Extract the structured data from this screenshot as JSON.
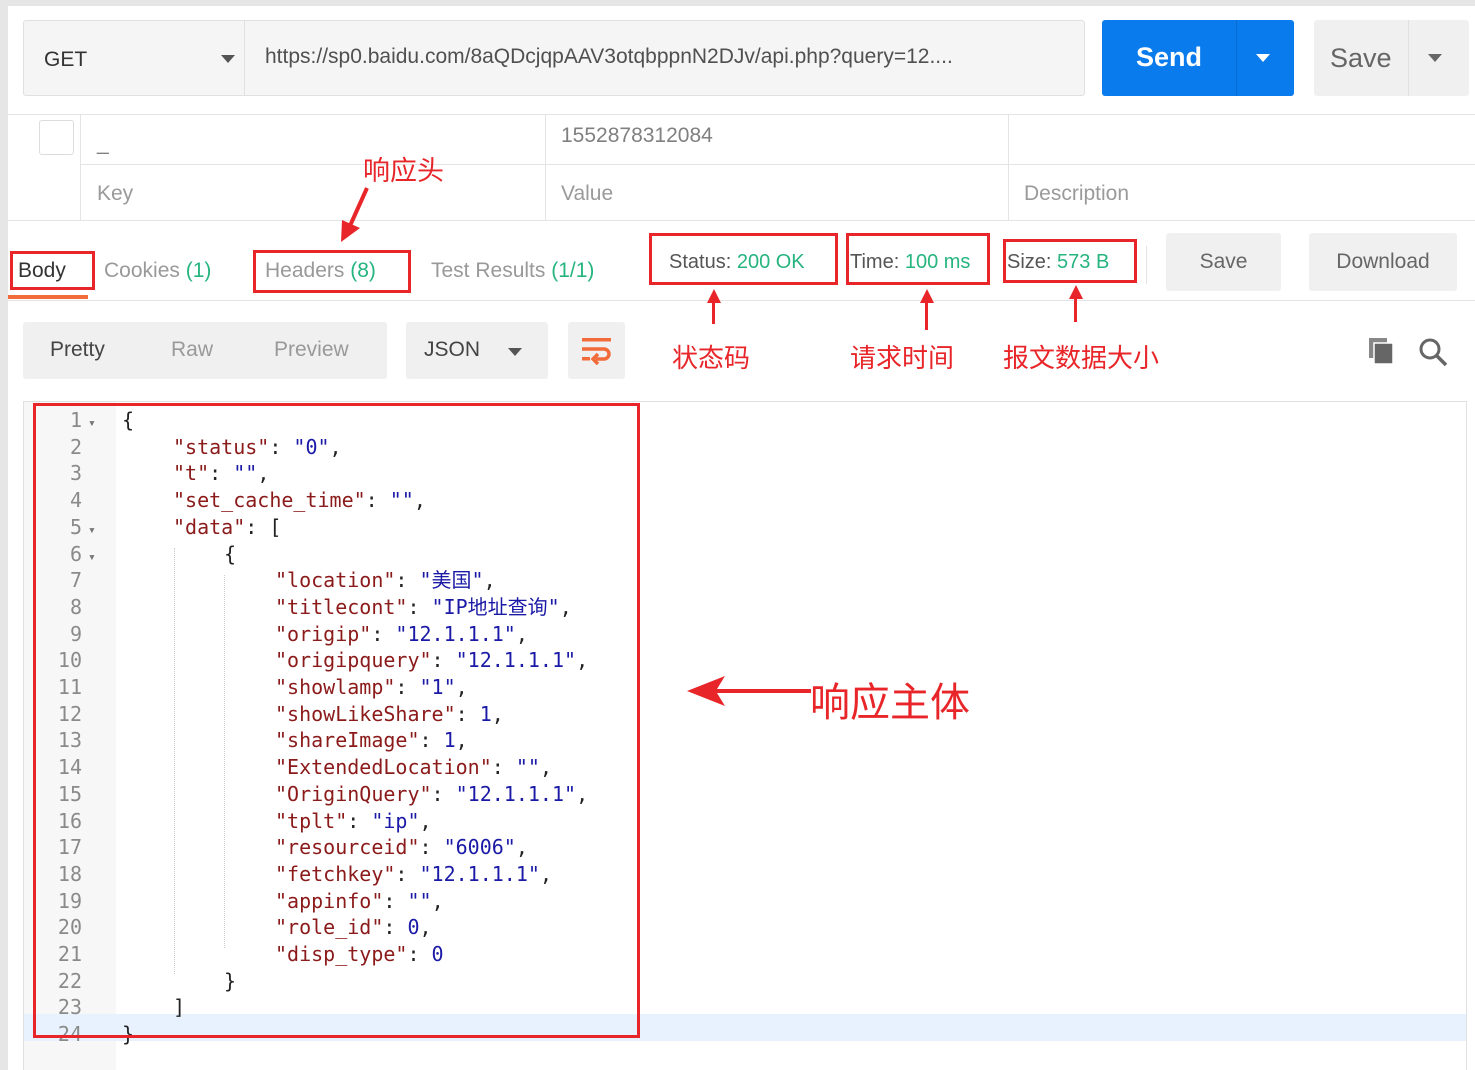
{
  "request": {
    "method": "GET",
    "url": "https://sp0.baidu.com/8aQDcjqpAAV3otqbppnN2DJv/api.php?query=12....",
    "send_label": "Send",
    "save_label": "Save"
  },
  "params": {
    "row": {
      "key": "_",
      "value": "1552878312084",
      "description": ""
    },
    "placeholders": {
      "key": "Key",
      "value": "Value",
      "description": "Description"
    }
  },
  "response": {
    "tabs": [
      {
        "label": "Body",
        "count": ""
      },
      {
        "label": "Cookies",
        "count": "(1)"
      },
      {
        "label": "Headers",
        "count": "(8)"
      },
      {
        "label": "Test Results",
        "count": "(1/1)"
      }
    ],
    "status_label": "Status:",
    "status_value": "200 OK",
    "time_label": "Time:",
    "time_value": "100 ms",
    "size_label": "Size:",
    "size_value": "573 B",
    "save_label": "Save",
    "download_label": "Download"
  },
  "body_toolbar": {
    "views": [
      "Pretty",
      "Raw",
      "Preview"
    ],
    "format": "JSON"
  },
  "editor": {
    "lines": [
      {
        "n": "1",
        "fold": true,
        "indent": 0,
        "parts": [
          [
            "punc",
            "{"
          ]
        ]
      },
      {
        "n": "2",
        "indent": 1,
        "parts": [
          [
            "key",
            "\"status\""
          ],
          [
            "punc",
            ": "
          ],
          [
            "str",
            "\"0\""
          ],
          [
            "punc",
            ","
          ]
        ]
      },
      {
        "n": "3",
        "indent": 1,
        "parts": [
          [
            "key",
            "\"t\""
          ],
          [
            "punc",
            ": "
          ],
          [
            "str",
            "\"\""
          ],
          [
            "punc",
            ","
          ]
        ]
      },
      {
        "n": "4",
        "indent": 1,
        "parts": [
          [
            "key",
            "\"set_cache_time\""
          ],
          [
            "punc",
            ": "
          ],
          [
            "str",
            "\"\""
          ],
          [
            "punc",
            ","
          ]
        ]
      },
      {
        "n": "5",
        "fold": true,
        "indent": 1,
        "parts": [
          [
            "key",
            "\"data\""
          ],
          [
            "punc",
            ": ["
          ]
        ]
      },
      {
        "n": "6",
        "fold": true,
        "indent": 2,
        "parts": [
          [
            "punc",
            "{"
          ]
        ]
      },
      {
        "n": "7",
        "indent": 3,
        "parts": [
          [
            "key",
            "\"location\""
          ],
          [
            "punc",
            ": "
          ],
          [
            "str",
            "\"美国\""
          ],
          [
            "punc",
            ","
          ]
        ]
      },
      {
        "n": "8",
        "indent": 3,
        "parts": [
          [
            "key",
            "\"titlecont\""
          ],
          [
            "punc",
            ": "
          ],
          [
            "str",
            "\"IP地址查询\""
          ],
          [
            "punc",
            ","
          ]
        ]
      },
      {
        "n": "9",
        "indent": 3,
        "parts": [
          [
            "key",
            "\"origip\""
          ],
          [
            "punc",
            ": "
          ],
          [
            "str",
            "\"12.1.1.1\""
          ],
          [
            "punc",
            ","
          ]
        ]
      },
      {
        "n": "10",
        "indent": 3,
        "parts": [
          [
            "key",
            "\"origipquery\""
          ],
          [
            "punc",
            ": "
          ],
          [
            "str",
            "\"12.1.1.1\""
          ],
          [
            "punc",
            ","
          ]
        ]
      },
      {
        "n": "11",
        "indent": 3,
        "parts": [
          [
            "key",
            "\"showlamp\""
          ],
          [
            "punc",
            ": "
          ],
          [
            "str",
            "\"1\""
          ],
          [
            "punc",
            ","
          ]
        ]
      },
      {
        "n": "12",
        "indent": 3,
        "parts": [
          [
            "key",
            "\"showLikeShare\""
          ],
          [
            "punc",
            ": "
          ],
          [
            "num",
            "1"
          ],
          [
            "punc",
            ","
          ]
        ]
      },
      {
        "n": "13",
        "indent": 3,
        "parts": [
          [
            "key",
            "\"shareImage\""
          ],
          [
            "punc",
            ": "
          ],
          [
            "num",
            "1"
          ],
          [
            "punc",
            ","
          ]
        ]
      },
      {
        "n": "14",
        "indent": 3,
        "parts": [
          [
            "key",
            "\"ExtendedLocation\""
          ],
          [
            "punc",
            ": "
          ],
          [
            "str",
            "\"\""
          ],
          [
            "punc",
            ","
          ]
        ]
      },
      {
        "n": "15",
        "indent": 3,
        "parts": [
          [
            "key",
            "\"OriginQuery\""
          ],
          [
            "punc",
            ": "
          ],
          [
            "str",
            "\"12.1.1.1\""
          ],
          [
            "punc",
            ","
          ]
        ]
      },
      {
        "n": "16",
        "indent": 3,
        "parts": [
          [
            "key",
            "\"tplt\""
          ],
          [
            "punc",
            ": "
          ],
          [
            "str",
            "\"ip\""
          ],
          [
            "punc",
            ","
          ]
        ]
      },
      {
        "n": "17",
        "indent": 3,
        "parts": [
          [
            "key",
            "\"resourceid\""
          ],
          [
            "punc",
            ": "
          ],
          [
            "str",
            "\"6006\""
          ],
          [
            "punc",
            ","
          ]
        ]
      },
      {
        "n": "18",
        "indent": 3,
        "parts": [
          [
            "key",
            "\"fetchkey\""
          ],
          [
            "punc",
            ": "
          ],
          [
            "str",
            "\"12.1.1.1\""
          ],
          [
            "punc",
            ","
          ]
        ]
      },
      {
        "n": "19",
        "indent": 3,
        "parts": [
          [
            "key",
            "\"appinfo\""
          ],
          [
            "punc",
            ": "
          ],
          [
            "str",
            "\"\""
          ],
          [
            "punc",
            ","
          ]
        ]
      },
      {
        "n": "20",
        "indent": 3,
        "parts": [
          [
            "key",
            "\"role_id\""
          ],
          [
            "punc",
            ": "
          ],
          [
            "num",
            "0"
          ],
          [
            "punc",
            ","
          ]
        ]
      },
      {
        "n": "21",
        "indent": 3,
        "parts": [
          [
            "key",
            "\"disp_type\""
          ],
          [
            "punc",
            ": "
          ],
          [
            "num",
            "0"
          ]
        ]
      },
      {
        "n": "22",
        "indent": 2,
        "parts": [
          [
            "punc",
            "}"
          ]
        ]
      },
      {
        "n": "23",
        "indent": 1,
        "parts": [
          [
            "punc",
            "]"
          ]
        ]
      },
      {
        "n": "24",
        "indent": 0,
        "parts": [
          [
            "punc",
            "}"
          ]
        ]
      }
    ]
  },
  "annotations": {
    "headers": "响应头",
    "status": "状态码",
    "time": "请求时间",
    "size": "报文数据大小",
    "body": "响应主体"
  },
  "colors": {
    "accent": "#097bed",
    "success": "#26b47f",
    "annotation": "#e8262a",
    "tab_underline": "#f26b3a"
  },
  "icons": [
    "chevron-down-icon",
    "wrap-lines-icon",
    "copy-icon",
    "search-icon"
  ]
}
